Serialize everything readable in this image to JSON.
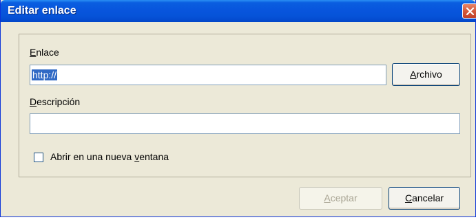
{
  "dialog": {
    "title": "Editar enlace",
    "link": {
      "label_accel": "E",
      "label_rest": "nlace",
      "value": "http://",
      "browse_accel": "A",
      "browse_rest": "rchivo"
    },
    "description": {
      "label_accel": "D",
      "label_rest": "escripción",
      "value": ""
    },
    "new_window": {
      "label_pre": "Abrir en una nueva ",
      "label_accel": "v",
      "label_post": "entana",
      "checked": false
    },
    "ok": {
      "accel": "A",
      "rest": "ceptar",
      "enabled": false
    },
    "cancel": {
      "accel": "C",
      "rest": "ancelar"
    }
  },
  "icons": {
    "close": "close-icon",
    "checkbox": "checkbox-unchecked"
  },
  "colors": {
    "title_bar": "#0855dd",
    "window_bg": "#ece9d8",
    "selection": "#316ac5"
  }
}
